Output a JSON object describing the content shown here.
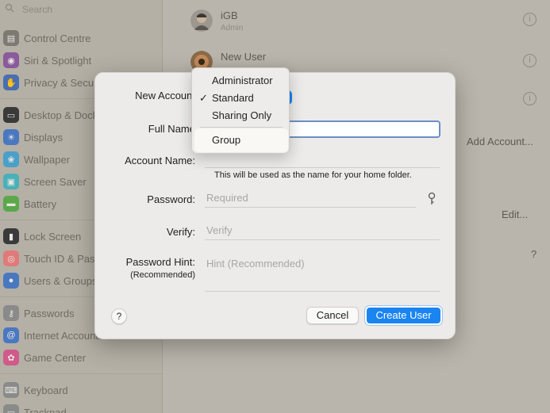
{
  "sidebar": {
    "search_placeholder": "Search",
    "items": [
      {
        "label": "Control Centre",
        "icon": "control-centre-icon",
        "color": "#7d7a74"
      },
      {
        "label": "Siri & Spotlight",
        "icon": "siri-icon",
        "color": "#8a5a9a"
      },
      {
        "label": "Privacy & Security",
        "icon": "hand-icon",
        "color": "#4a6fb0"
      },
      {
        "label": "Desktop & Dock",
        "icon": "dock-icon",
        "color": "#3a3a3a"
      },
      {
        "label": "Displays",
        "icon": "displays-icon",
        "color": "#4a78c0"
      },
      {
        "label": "Wallpaper",
        "icon": "wallpaper-icon",
        "color": "#4aa0c8"
      },
      {
        "label": "Screen Saver",
        "icon": "screen-saver-icon",
        "color": "#4ab0b8"
      },
      {
        "label": "Battery",
        "icon": "battery-icon",
        "color": "#5aa84a"
      },
      {
        "label": "Lock Screen",
        "icon": "lock-icon",
        "color": "#3a3a3a"
      },
      {
        "label": "Touch ID & Password",
        "icon": "fingerprint-icon",
        "color": "#e07a7a"
      },
      {
        "label": "Users & Groups",
        "icon": "users-icon",
        "color": "#4a78c0"
      },
      {
        "label": "Passwords",
        "icon": "key-icon",
        "color": "#8a8a8a"
      },
      {
        "label": "Internet Accounts",
        "icon": "at-icon",
        "color": "#4a78c0"
      },
      {
        "label": "Game Center",
        "icon": "game-center-icon",
        "color": "#d05a8a"
      },
      {
        "label": "Keyboard",
        "icon": "keyboard-icon",
        "color": "#8a8a8a"
      },
      {
        "label": "Trackpad",
        "icon": "trackpad-icon",
        "color": "#8a8a8a"
      }
    ]
  },
  "main": {
    "users": [
      {
        "name": "iGB",
        "sub": "Admin"
      },
      {
        "name": "New User",
        "sub": ""
      },
      {
        "name": "",
        "sub": ""
      }
    ],
    "add_account_label": "Add Account...",
    "edit_label": "Edit...",
    "help_label": "?"
  },
  "dialog": {
    "new_account_label": "New Account",
    "full_name_label": "Full Name",
    "account_name_label": "Account Name:",
    "account_name_note": "This will be used as the name for your home folder.",
    "password_label": "Password:",
    "password_placeholder": "Required",
    "verify_label": "Verify:",
    "verify_placeholder": "Verify",
    "hint_label": "Password Hint:",
    "hint_sublabel": "(Recommended)",
    "hint_placeholder": "Hint (Recommended)",
    "help_label": "?",
    "cancel_label": "Cancel",
    "create_label": "Create User"
  },
  "menu": {
    "items": [
      {
        "label": "Administrator",
        "checked": false
      },
      {
        "label": "Standard",
        "checked": true
      },
      {
        "label": "Sharing Only",
        "checked": false
      }
    ],
    "extra_item": {
      "label": "Group",
      "highlighted": true
    },
    "check_glyph": "✓"
  },
  "colors": {
    "accent": "#1a84f0",
    "focus_ring": "#6e8fc4",
    "dim_overlay": "#b9b5ac"
  }
}
